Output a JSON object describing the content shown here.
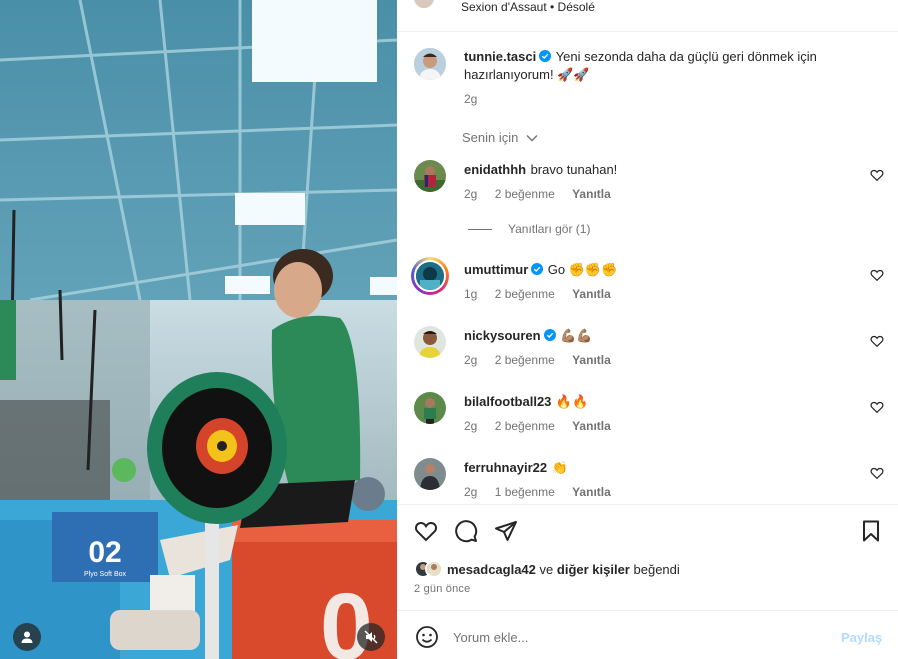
{
  "header": {
    "subtitle": "Sexion d'Assaut • Désolé"
  },
  "caption": {
    "username": "tunnie.tasci",
    "verified": true,
    "text": "Yeni sezonda daha da güçlü geri dönmek için hazırlanıyorum! 🚀🚀",
    "time": "2g"
  },
  "filter": {
    "label": "Senin için"
  },
  "comments": [
    {
      "username": "enidathhh",
      "verified": false,
      "text": "bravo tunahan!",
      "time": "2g",
      "likes": "2 beğenme",
      "reply": "Yanıtla",
      "view_replies": "Yanıtları gör (1)"
    },
    {
      "username": "umuttimur",
      "verified": true,
      "text": "Go ✊✊✊",
      "time": "1g",
      "likes": "2 beğenme",
      "reply": "Yanıtla"
    },
    {
      "username": "nickysouren",
      "verified": true,
      "text": "💪🏽💪🏽",
      "time": "2g",
      "likes": "2 beğenme",
      "reply": "Yanıtla"
    },
    {
      "username": "bilalfootball23",
      "verified": false,
      "text": "🔥🔥",
      "time": "2g",
      "likes": "2 beğenme",
      "reply": "Yanıtla"
    },
    {
      "username": "ferruhnayir22",
      "verified": false,
      "text": "👏",
      "time": "2g",
      "likes": "1 beğenme",
      "reply": "Yanıtla"
    }
  ],
  "likes": {
    "liker": "mesadcagla42",
    "connector": "ve",
    "others": "diğer kişiler",
    "suffix": "beğendi"
  },
  "post_date": "2 gün önce",
  "composer": {
    "placeholder": "Yorum ekle...",
    "share_label": "Paylaş"
  },
  "media": {
    "box_number": "02",
    "box_label": "Plyo Soft Box"
  },
  "colors": {
    "accent_blue": "#0095f6",
    "share_disabled": "#b3dbff",
    "muted_text": "#737373"
  }
}
